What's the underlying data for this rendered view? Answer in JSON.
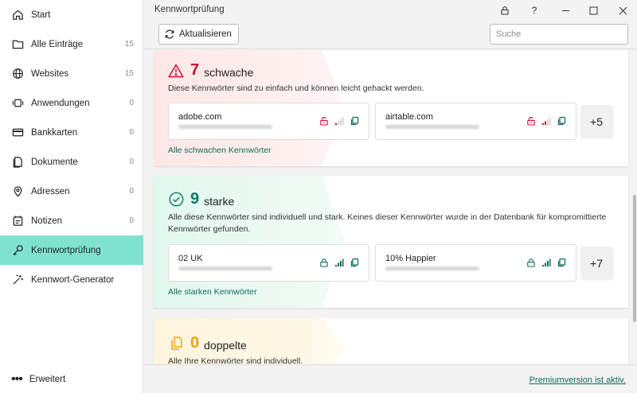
{
  "window": {
    "title": "Kennwortprüfung"
  },
  "sidebar": {
    "items": [
      {
        "label": "Start",
        "count": "",
        "icon": "home-icon"
      },
      {
        "label": "Alle Einträge",
        "count": "15",
        "icon": "folder-icon"
      },
      {
        "label": "Websites",
        "count": "15",
        "icon": "globe-icon"
      },
      {
        "label": "Anwendungen",
        "count": "0",
        "icon": "apps-icon"
      },
      {
        "label": "Bankkarten",
        "count": "0",
        "icon": "card-icon"
      },
      {
        "label": "Dokumente",
        "count": "0",
        "icon": "document-icon"
      },
      {
        "label": "Adressen",
        "count": "0",
        "icon": "location-pin-icon"
      },
      {
        "label": "Notizen",
        "count": "0",
        "icon": "notes-icon"
      },
      {
        "label": "Kennwortprüfung",
        "count": "",
        "icon": "key-icon",
        "active": true
      },
      {
        "label": "Kennwort-Generator",
        "count": "",
        "icon": "magic-wand-icon"
      }
    ],
    "expand_label": "Erweitert"
  },
  "toolbar": {
    "refresh_label": "Aktualisieren",
    "search_placeholder": "Suche"
  },
  "weak": {
    "count": "7",
    "label": "schwache",
    "description": "Diese Kennwörter sind zu einfach und können leicht gehackt werden.",
    "entries": [
      {
        "name": "adobe.com"
      },
      {
        "name": "airtable.com"
      }
    ],
    "more": "+5",
    "link": "Alle schwachen Kennwörter",
    "color": "#c8102e"
  },
  "strong": {
    "count": "9",
    "label": "starke",
    "description": "Alle diese Kennwörter sind individuell und stark. Keines dieser Kennwörter wurde in der Datenbank für kompromittierte Kennwörter gefunden.",
    "entries": [
      {
        "name": "02 UK"
      },
      {
        "name": "10% Happier"
      }
    ],
    "more": "+7",
    "link": "Alle starken Kennwörter",
    "color": "#0b7a62"
  },
  "duplicate": {
    "count": "0",
    "label": "doppelte",
    "description": "Alle Ihre Kennwörter sind individuell.",
    "color": "#e8a317"
  },
  "footer": {
    "premium_label": "Premiumversion ist aktiv."
  }
}
